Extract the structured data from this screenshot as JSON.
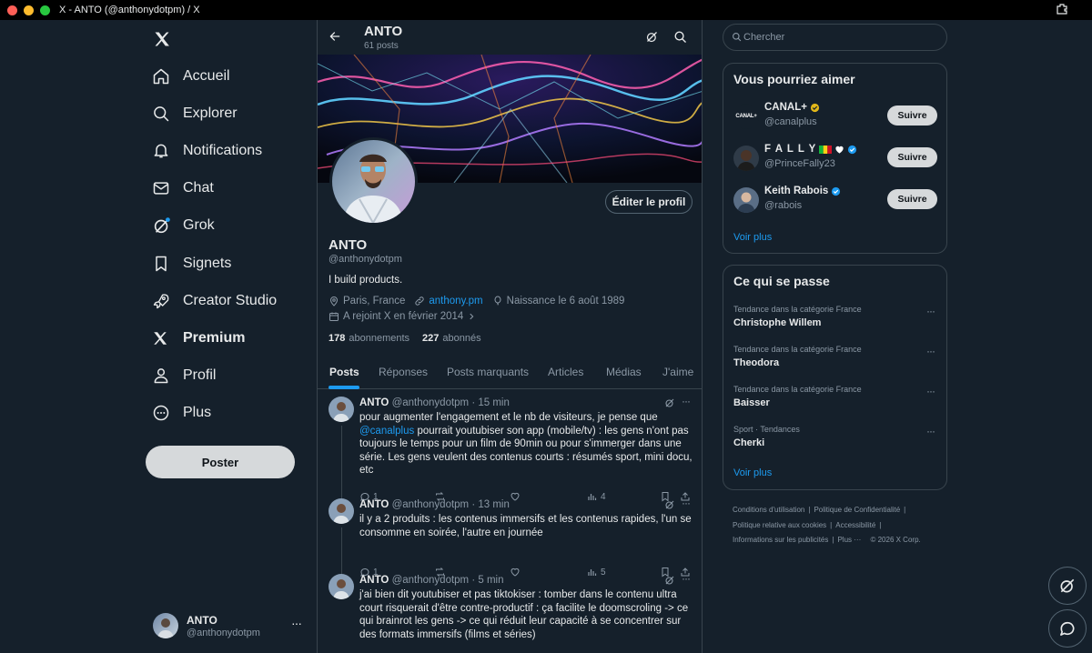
{
  "window": {
    "title": "X - ANTO (@anthonydotpm) / X"
  },
  "nav": {
    "items": [
      {
        "label": "Accueil",
        "icon": "home-icon"
      },
      {
        "label": "Explorer",
        "icon": "search-icon"
      },
      {
        "label": "Notifications",
        "icon": "bell-icon"
      },
      {
        "label": "Chat",
        "icon": "mail-icon"
      },
      {
        "label": "Grok",
        "icon": "grok-icon"
      },
      {
        "label": "Signets",
        "icon": "bookmark-icon"
      },
      {
        "label": "Creator Studio",
        "icon": "rocket-icon"
      },
      {
        "label": "Premium",
        "icon": "x-logo-icon"
      },
      {
        "label": "Profil",
        "icon": "person-icon"
      },
      {
        "label": "Plus",
        "icon": "more-circle-icon"
      }
    ],
    "post_label": "Poster",
    "account": {
      "name": "ANTO",
      "handle": "@anthonydotpm",
      "more": "···"
    }
  },
  "profile": {
    "header_name": "ANTO",
    "post_count": "61 posts",
    "name": "ANTO",
    "handle": "@anthonydotpm",
    "bio": "I build products.",
    "location": "Paris, France",
    "website": "anthony.pm",
    "birthday": "Naissance le 6 août 1989",
    "joined": "A rejoint X en février 2014",
    "following_count": "178",
    "following_label": "abonnements",
    "followers_count": "227",
    "followers_label": "abonnés",
    "edit_label": "Éditer le profil"
  },
  "tabs": [
    "Posts",
    "Réponses",
    "Posts marquants",
    "Articles",
    "Médias",
    "J'aime"
  ],
  "tweets": [
    {
      "name": "ANTO",
      "handle": "@anthonydotpm",
      "time": "· 15 min",
      "text_before": "pour augmenter l'engagement et le nb de visiteurs, je pense que ",
      "mention": "@canalplus",
      "text_after": " pourrait youtubiser son app (mobile/tv) : les gens n'ont pas toujours le temps pour un film de 90min ou pour s'immerger dans une série. Les gens veulent des contenus courts : résumés sport, mini docu, etc",
      "replies": "1",
      "views": "4"
    },
    {
      "name": "ANTO",
      "handle": "@anthonydotpm",
      "time": "· 13 min",
      "text": "il y a 2 produits : les contenus immersifs et les contenus rapides, l'un se consomme en soirée, l'autre en journée",
      "replies": "1",
      "views": "5"
    },
    {
      "name": "ANTO",
      "handle": "@anthonydotpm",
      "time": "· 5 min",
      "text": "j'ai bien dit youtubiser et pas tiktokiser : tomber dans le contenu ultra court risquerait d'être contre-productif : ça facilite le doomscroling -> ce qui brainrot les gens -> ce qui réduit leur capacité à se concentrer sur des formats immersifs (films et séries)"
    }
  ],
  "right": {
    "search_placeholder": "Chercher",
    "suggestions_title": "Vous pourriez aimer",
    "suggestions": [
      {
        "name": "CANAL+",
        "handle": "@canalplus",
        "logo_text": "CANAL+",
        "badge_color": "#e2b719"
      },
      {
        "name": "F A L L Y",
        "handle": "@PrinceFally23",
        "badge_color": "#1d9bf0"
      },
      {
        "name": "Keith Rabois",
        "handle": "@rabois",
        "badge_color": "#1d9bf0"
      }
    ],
    "follow_label": "Suivre",
    "see_more": "Voir plus",
    "trends_title": "Ce qui se passe",
    "trends": [
      {
        "context": "Tendance dans la catégorie France",
        "title": "Christophe Willem"
      },
      {
        "context": "Tendance dans la catégorie France",
        "title": "Theodora"
      },
      {
        "context": "Tendance dans la catégorie France",
        "title": "Baisser"
      },
      {
        "context": "Sport · Tendances",
        "title": "Cherki"
      }
    ],
    "trends_more": "Voir plus",
    "footer": {
      "terms": "Conditions d'utilisation",
      "privacy": "Politique de Confidentialité",
      "cookies": "Politique relative aux cookies",
      "accessibility": "Accessibilité",
      "ads": "Informations sur les publicités",
      "more": "Plus ···",
      "copyright": "© 2026 X Corp."
    }
  },
  "colors": {
    "accent": "#1d9bf0",
    "background": "#15202b",
    "border": "#38444d",
    "muted": "#8b98a5"
  }
}
